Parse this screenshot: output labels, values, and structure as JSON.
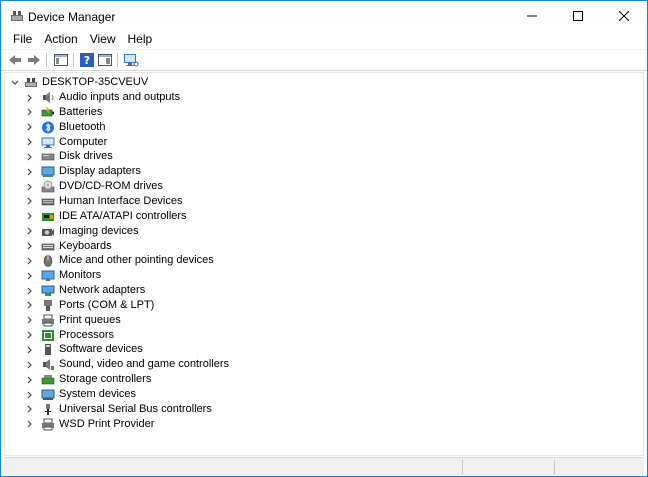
{
  "window": {
    "title": "Device Manager"
  },
  "menu": [
    "File",
    "Action",
    "View",
    "Help"
  ],
  "toolbar": {
    "buttons": [
      "back-arrow-icon",
      "forward-arrow-icon",
      "show-hide-console-tree-icon",
      "help-icon",
      "properties-icon",
      "monitor-scan-icon"
    ]
  },
  "tree": {
    "root": "DESKTOP-35CVEUV",
    "items": [
      {
        "label": "Audio inputs and outputs",
        "icon": "speaker-icon"
      },
      {
        "label": "Batteries",
        "icon": "battery-icon"
      },
      {
        "label": "Bluetooth",
        "icon": "bluetooth-icon"
      },
      {
        "label": "Computer",
        "icon": "computer-icon"
      },
      {
        "label": "Disk drives",
        "icon": "disk-drive-icon"
      },
      {
        "label": "Display adapters",
        "icon": "display-adapter-icon"
      },
      {
        "label": "DVD/CD-ROM drives",
        "icon": "dvd-drive-icon"
      },
      {
        "label": "Human Interface Devices",
        "icon": "hid-icon"
      },
      {
        "label": "IDE ATA/ATAPI controllers",
        "icon": "ide-controller-icon"
      },
      {
        "label": "Imaging devices",
        "icon": "camera-icon"
      },
      {
        "label": "Keyboards",
        "icon": "keyboard-icon"
      },
      {
        "label": "Mice and other pointing devices",
        "icon": "mouse-icon"
      },
      {
        "label": "Monitors",
        "icon": "monitor-icon"
      },
      {
        "label": "Network adapters",
        "icon": "network-adapter-icon"
      },
      {
        "label": "Ports (COM & LPT)",
        "icon": "port-icon"
      },
      {
        "label": "Print queues",
        "icon": "printer-icon"
      },
      {
        "label": "Processors",
        "icon": "processor-icon"
      },
      {
        "label": "Software devices",
        "icon": "software-device-icon"
      },
      {
        "label": "Sound, video and game controllers",
        "icon": "sound-controller-icon"
      },
      {
        "label": "Storage controllers",
        "icon": "storage-controller-icon"
      },
      {
        "label": "System devices",
        "icon": "system-device-icon"
      },
      {
        "label": "Universal Serial Bus controllers",
        "icon": "usb-icon"
      },
      {
        "label": "WSD Print Provider",
        "icon": "wsd-printer-icon"
      }
    ]
  },
  "colors": {
    "window_border": "#1883d7",
    "icon_blue": "#2b7cd3"
  }
}
